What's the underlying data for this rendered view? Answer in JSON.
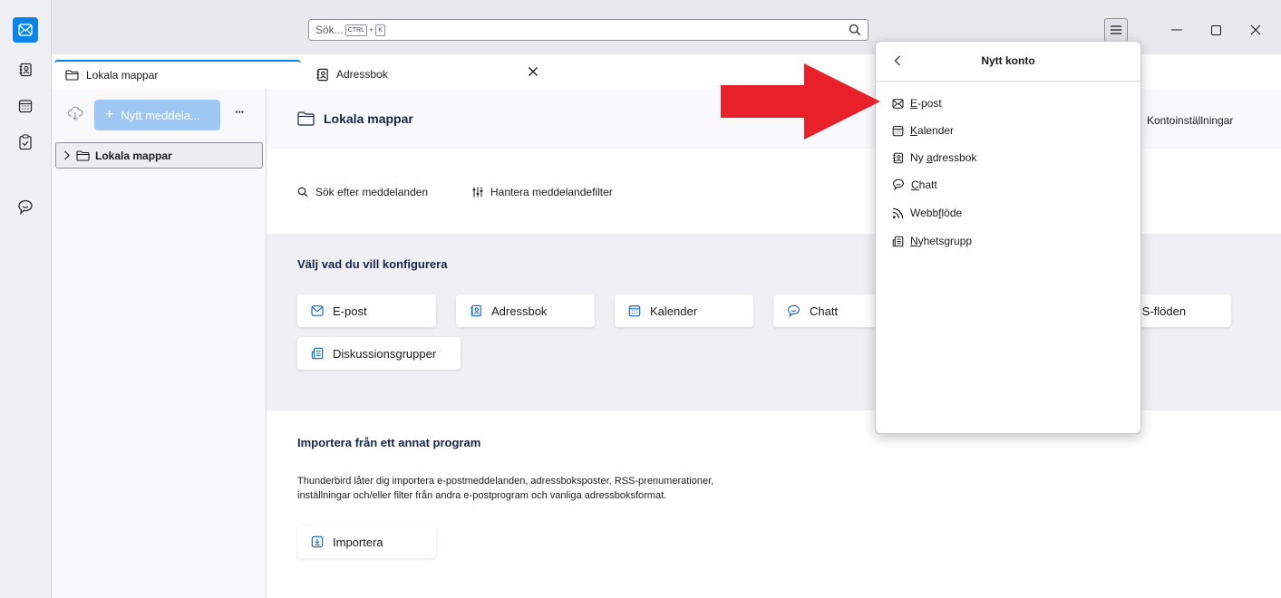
{
  "spaces": {
    "items": [
      {
        "icon": "mail-icon",
        "active": true
      },
      {
        "icon": "address-book-icon",
        "active": false
      },
      {
        "icon": "calendar-icon",
        "active": false
      },
      {
        "icon": "tasks-icon",
        "active": false
      },
      {
        "icon": "chat-icon",
        "active": false
      }
    ]
  },
  "search": {
    "placeholder": "Sök...",
    "shortcut_ctrl": "CTRL",
    "shortcut_plus": "+",
    "shortcut_key": "K"
  },
  "tabs": [
    {
      "label": "Lokala mappar",
      "icon": "folder-icon",
      "selected": true
    },
    {
      "label": "Adressbok",
      "icon": "address-book-icon",
      "selected": false
    }
  ],
  "folder_pane": {
    "new_message_label": "Nytt meddela...",
    "more_label": "···",
    "folder_label": "Lokala mappar"
  },
  "main": {
    "title": "Lokala mappar",
    "account_settings": "Kontoinställningar",
    "search_messages": "Sök efter meddelanden",
    "manage_filters": "Hantera meddelandefilter",
    "configure_heading": "Välj vad du vill konfigurera",
    "cards": {
      "email": "E-post",
      "addressbook": "Adressbok",
      "calendar": "Kalender",
      "chat": "Chatt",
      "rss": "SS-flöden",
      "newsgroups": "Diskussionsgrupper"
    },
    "import_heading": "Importera från ett annat program",
    "import_text_1": "Thunderbird låter dig importera e-postmeddelanden, adressboksposter, RSS-prenumerationer,",
    "import_text_2": "inställningar och/eller filter från andra e-postprogram och vanliga adressboksformat.",
    "import_button": "Importera"
  },
  "popup": {
    "title": "Nytt konto",
    "items": [
      {
        "pre": "",
        "key": "E",
        "post": "-post",
        "icon": "mail-icon"
      },
      {
        "pre": "",
        "key": "K",
        "post": "alender",
        "icon": "calendar-icon"
      },
      {
        "pre": "Ny ",
        "key": "a",
        "post": "dressbok",
        "icon": "address-book-icon"
      },
      {
        "pre": "",
        "key": "C",
        "post": "hatt",
        "icon": "chat-icon"
      },
      {
        "pre": "Webb",
        "key": "f",
        "post": "löde",
        "icon": "rss-icon"
      },
      {
        "pre": "",
        "key": "N",
        "post": "yhetsgrupp",
        "icon": "newsgroup-icon"
      }
    ]
  },
  "colors": {
    "accent": "#0b84e8",
    "arrow": "#e8202a",
    "heading": "#15264a"
  }
}
